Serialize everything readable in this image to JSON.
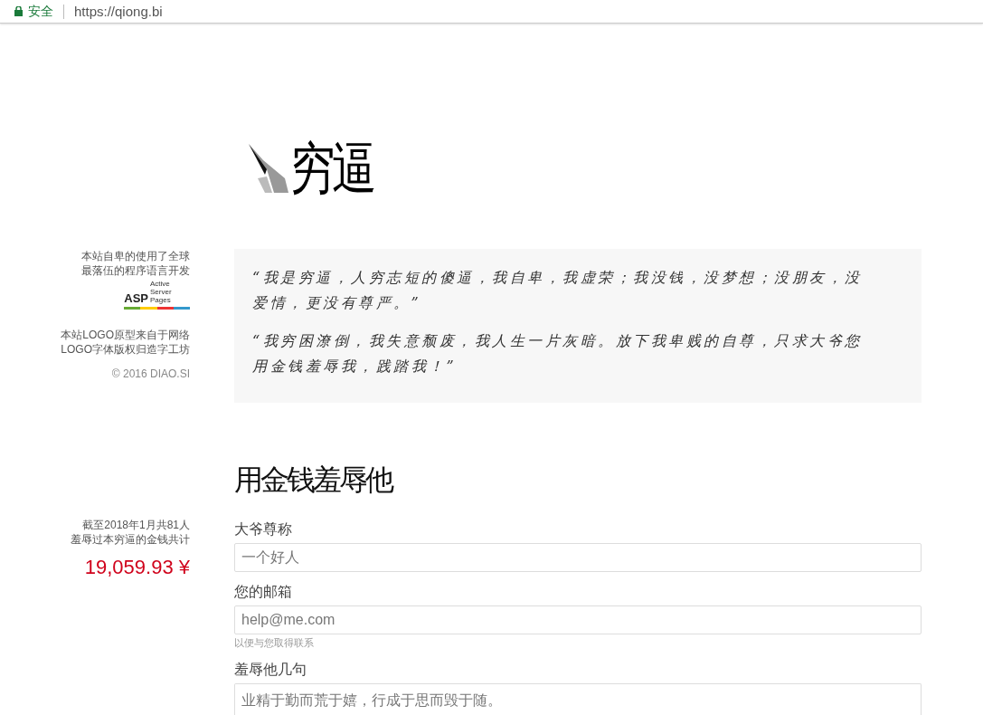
{
  "browser": {
    "security_label": "安全",
    "url": "https://qiong.bi"
  },
  "logo": {
    "title": "穷逼"
  },
  "sidebar": {
    "credits": [
      [
        "本站自卑的使用了全球",
        "最落伍的程序语言开发"
      ],
      [
        "本站LOGO原型来自于网络",
        "LOGO字体版权归造字工坊"
      ]
    ],
    "asp_logo": {
      "mark": "ASP",
      "caption": "Active Server Pages"
    },
    "copyright": "© 2016 DIAO.SI",
    "stats": {
      "caption": [
        "截至2018年1月共81人",
        "羞辱过本穷逼的金钱共计"
      ],
      "total": "19,059.93 ¥"
    }
  },
  "quotes": [
    "“我是穷逼，人穷志短的傻逼，我自卑，我虚荣；我没钱，没梦想；没朋友，没爱情，更没有尊严。”",
    "“我穷困潦倒，我失意颓废，我人生一片灰暗。放下我卑贱的自尊，只求大爷您用金钱羞辱我，践踏我！”"
  ],
  "form": {
    "heading": "用金钱羞辱他",
    "fields": [
      {
        "kind": "input",
        "label": "大爷尊称",
        "placeholder": "一个好人"
      },
      {
        "kind": "input",
        "label": "您的邮箱",
        "placeholder": "help@me.com",
        "help": "以便与您取得联系"
      },
      {
        "kind": "textarea",
        "label": "羞辱他几句",
        "placeholder": "业精于勤而荒于嬉，行成于思而毁于随。"
      }
    ]
  }
}
